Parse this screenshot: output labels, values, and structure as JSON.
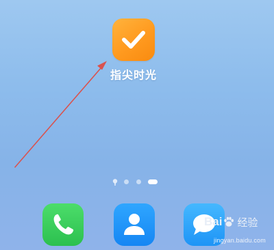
{
  "app": {
    "label": "指尖时光",
    "icon": "checkmark-icon",
    "color": "#ff9f22"
  },
  "annotation": {
    "color": "#d9534f"
  },
  "page_indicator": {
    "pages": 4,
    "current": 4
  },
  "dock": [
    {
      "name": "phone",
      "icon": "phone-icon",
      "color": "#34c759"
    },
    {
      "name": "contacts",
      "icon": "contacts-icon",
      "color": "#1a8cf5"
    },
    {
      "name": "messages",
      "icon": "message-bubble-icon",
      "color": "#2a9ef7"
    }
  ],
  "watermark": {
    "brand_left": "Bai",
    "brand_right": "经验",
    "url": "jingyan.baidu.com"
  }
}
